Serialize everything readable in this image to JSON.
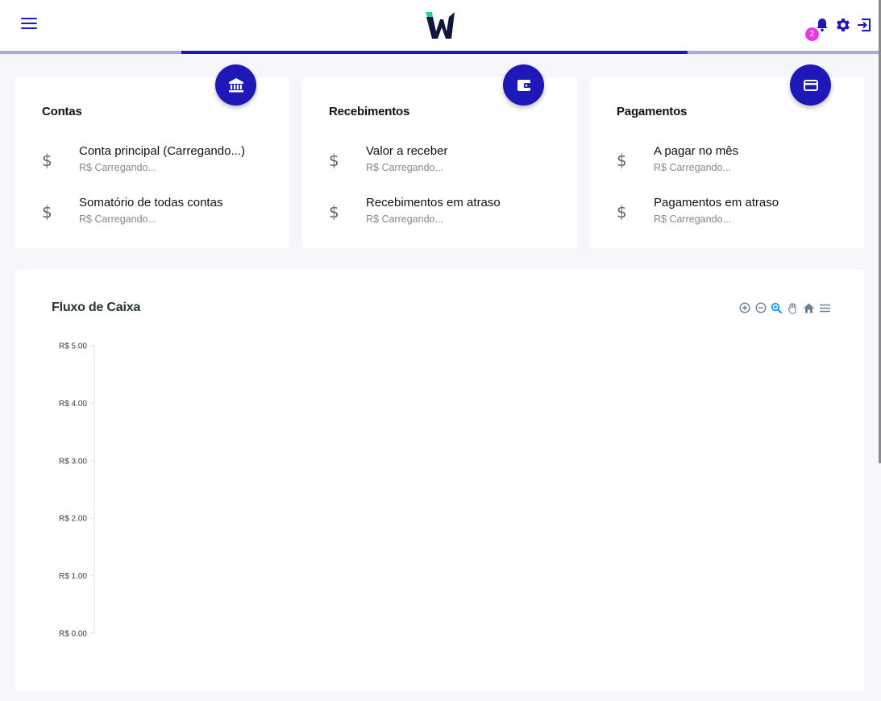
{
  "header": {
    "notification_count": "2",
    "brand_color": "#1e18b8",
    "icons": [
      "menu-icon",
      "logo-icon",
      "bell-icon",
      "gear-icon",
      "logout-icon"
    ]
  },
  "progress": {
    "value_percent": 57
  },
  "cards": [
    {
      "title": "Contas",
      "icon": "bank-icon",
      "items": [
        {
          "label": "Conta principal (Carregando...)",
          "value": "R$ Carregando..."
        },
        {
          "label": "Somatório de todas contas",
          "value": "R$ Carregando..."
        }
      ]
    },
    {
      "title": "Recebimentos",
      "icon": "wallet-icon",
      "items": [
        {
          "label": "Valor a receber",
          "value": "R$ Carregando..."
        },
        {
          "label": "Recebimentos em atraso",
          "value": "R$ Carregando..."
        }
      ]
    },
    {
      "title": "Pagamentos",
      "icon": "credit-card-icon",
      "items": [
        {
          "label": "A pagar no mês",
          "value": "R$ Carregando..."
        },
        {
          "label": "Pagamentos em atraso",
          "value": "R$ Carregando..."
        }
      ]
    }
  ],
  "currency_symbol": "$",
  "chart_data": {
    "type": "line",
    "title": "Fluxo de Caixa",
    "xlabel": "",
    "ylabel": "",
    "ylim": [
      0,
      5
    ],
    "y_ticks": [
      "R$ 0.00",
      "R$ 1.00",
      "R$ 2.00",
      "R$ 3.00",
      "R$ 4.00",
      "R$ 5.00"
    ],
    "series": [],
    "toolbar": [
      "zoom-in-icon",
      "zoom-out-icon",
      "selection-zoom-icon",
      "pan-icon",
      "reset-home-icon",
      "menu-icon"
    ],
    "grid": false
  }
}
